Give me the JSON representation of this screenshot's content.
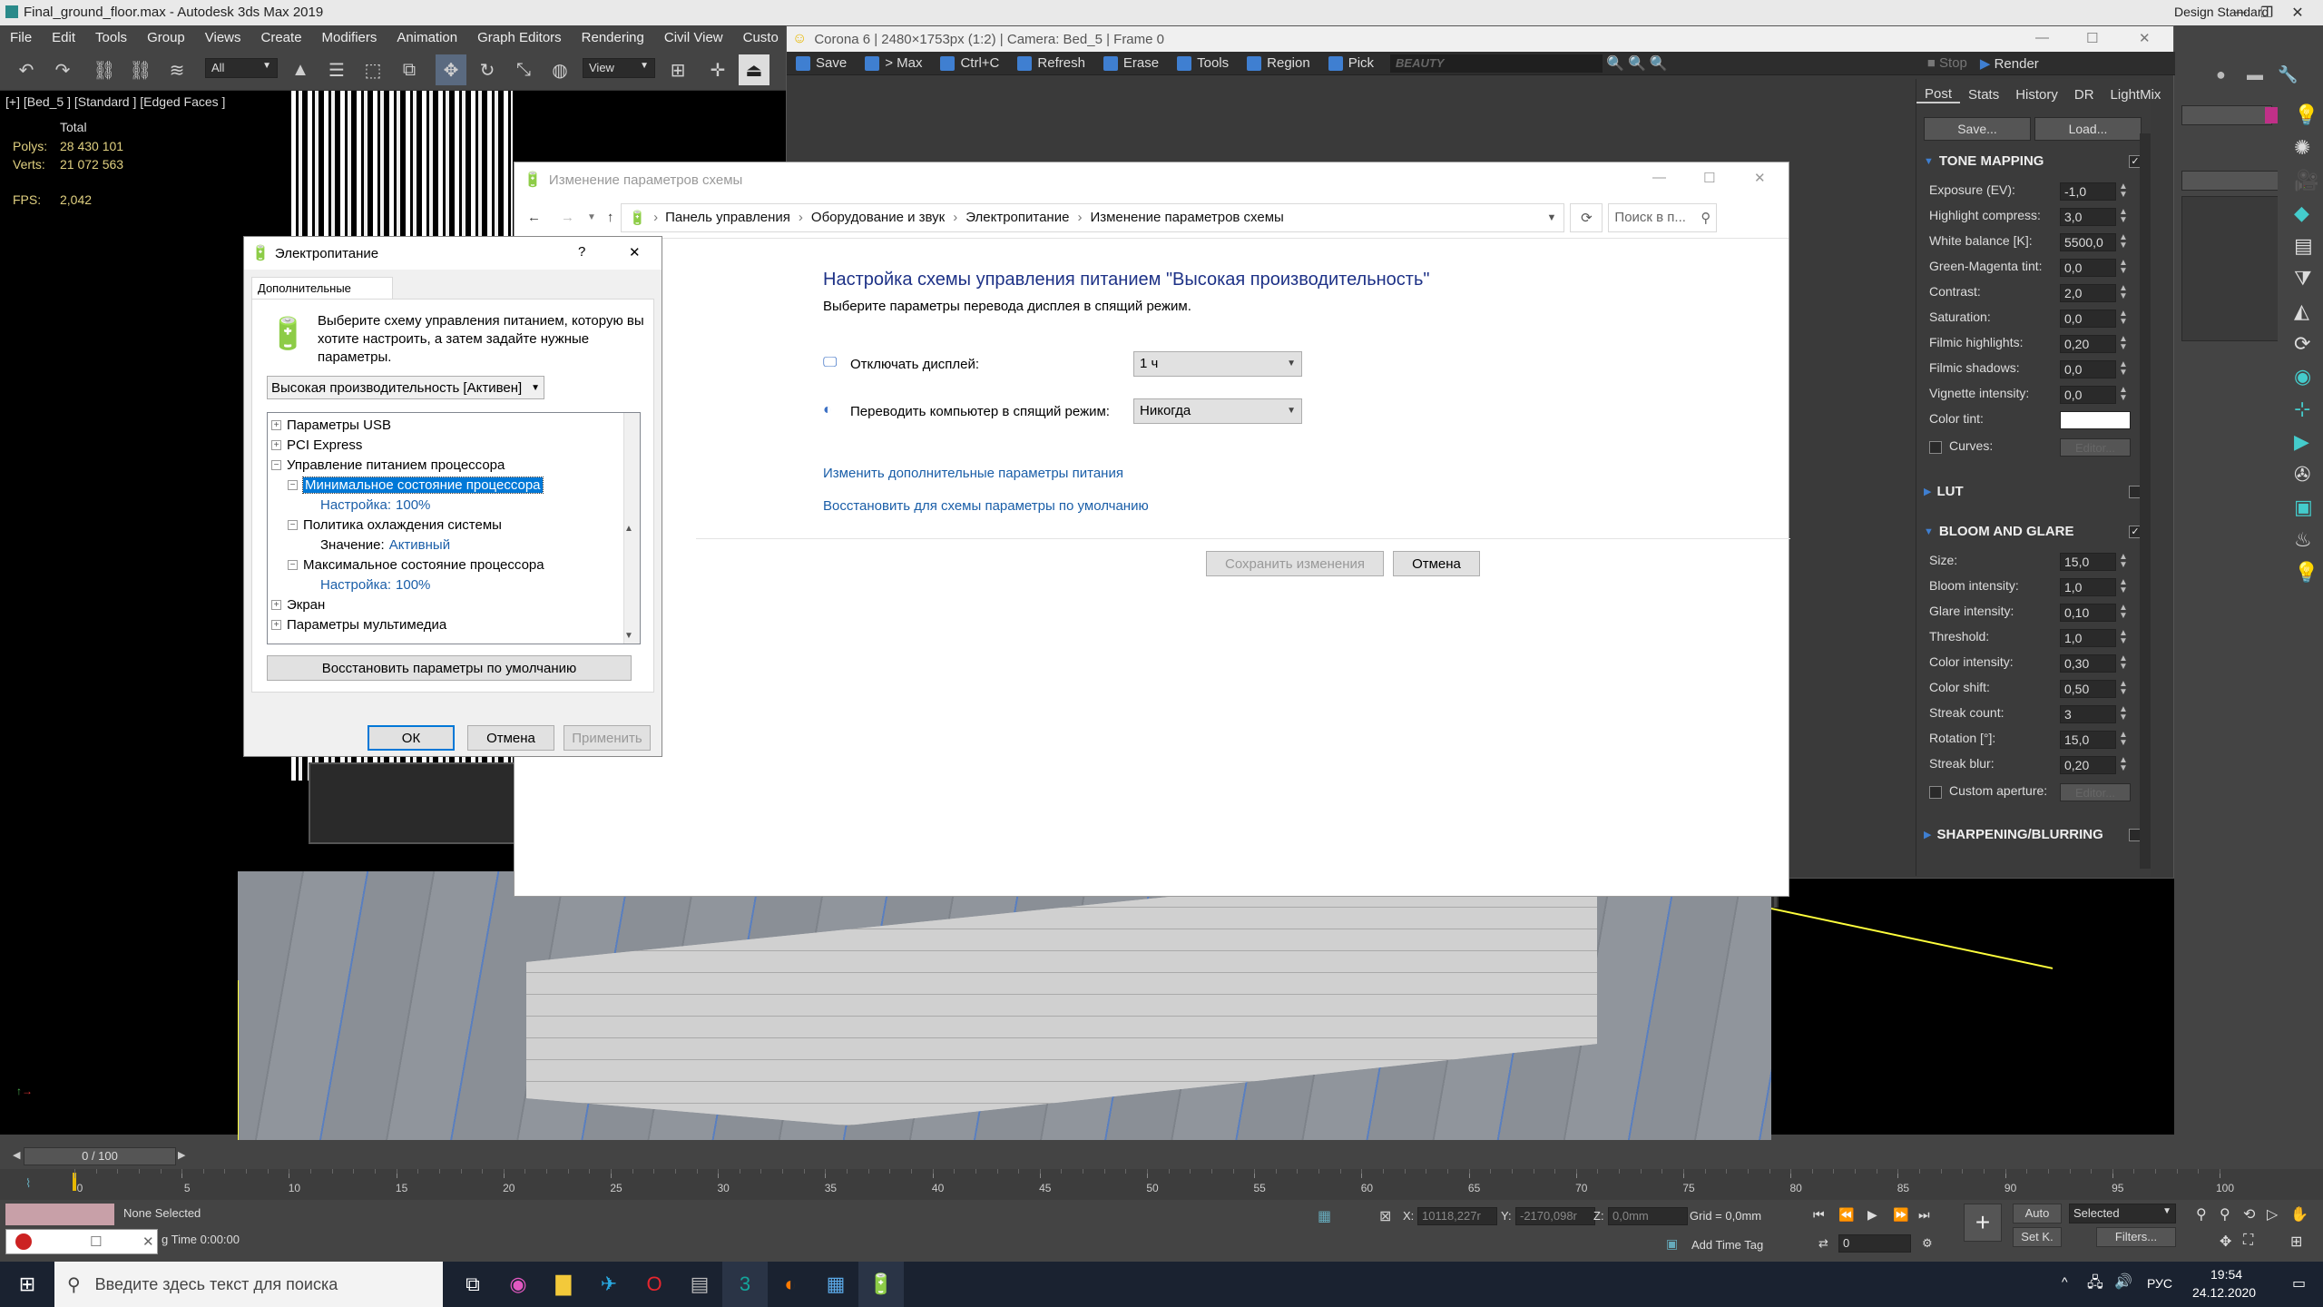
{
  "max": {
    "title": "Final_ground_floor.max - Autodesk 3ds Max 2019",
    "workspace": "Design Standard",
    "menu": [
      "File",
      "Edit",
      "Tools",
      "Group",
      "Views",
      "Create",
      "Modifiers",
      "Animation",
      "Graph Editors",
      "Rendering",
      "Civil View",
      "Custo"
    ],
    "selection_filter": "All",
    "view_dropdown": "View",
    "viewport_label": "[+] [Bed_5 ] [Standard ] [Edged Faces ]",
    "stats": {
      "total_label": "Total",
      "polys_label": "Polys:",
      "polys": "28 430 101",
      "verts_label": "Verts:",
      "verts": "21 072 563",
      "fps_label": "FPS:",
      "fps": "2,042"
    }
  },
  "corona": {
    "title": "Corona 6 | 2480×1753px (1:2) | Camera: Bed_5 | Frame 0",
    "toolbar": [
      "Save",
      "> Max",
      "Ctrl+C",
      "Refresh",
      "Erase",
      "Tools",
      "Region",
      "Pick"
    ],
    "channel": "BEAUTY",
    "stop": "Stop",
    "render": "Render",
    "tabs": [
      "Post",
      "Stats",
      "History",
      "DR",
      "LightMix"
    ],
    "save_btn": "Save...",
    "load_btn": "Load...",
    "tone_mapping": {
      "title": "TONE MAPPING",
      "rows": [
        {
          "label": "Exposure (EV):",
          "value": "-1,0"
        },
        {
          "label": "Highlight compress:",
          "value": "3,0"
        },
        {
          "label": "White balance [K]:",
          "value": "5500,0"
        },
        {
          "label": "Green-Magenta tint:",
          "value": "0,0"
        },
        {
          "label": "Contrast:",
          "value": "2,0"
        },
        {
          "label": "Saturation:",
          "value": "0,0"
        },
        {
          "label": "Filmic highlights:",
          "value": "0,20"
        },
        {
          "label": "Filmic shadows:",
          "value": "0,0"
        },
        {
          "label": "Vignette intensity:",
          "value": "0,0"
        }
      ],
      "color_tint": "Color tint:",
      "curves": "Curves:",
      "editor": "Editor..."
    },
    "lut": "LUT",
    "bloom": {
      "title": "BLOOM AND GLARE",
      "rows": [
        {
          "label": "Size:",
          "value": "15,0"
        },
        {
          "label": "Bloom intensity:",
          "value": "1,0"
        },
        {
          "label": "Glare intensity:",
          "value": "0,10"
        },
        {
          "label": "Threshold:",
          "value": "1,0"
        },
        {
          "label": "Color intensity:",
          "value": "0,30"
        },
        {
          "label": "Color shift:",
          "value": "0,50"
        },
        {
          "label": "Streak count:",
          "value": "3"
        },
        {
          "label": "Rotation [°]:",
          "value": "15,0"
        },
        {
          "label": "Streak blur:",
          "value": "0,20"
        }
      ],
      "custom_aperture": "Custom aperture:",
      "editor": "Editor..."
    },
    "sharpening": "SHARPENING/BLURRING"
  },
  "cpl": {
    "title": "Изменение параметров схемы",
    "crumbs": [
      "Панель управления",
      "Оборудование и звук",
      "Электропитание",
      "Изменение параметров схемы"
    ],
    "search_placeholder": "Поиск в п...",
    "heading": "Настройка схемы управления питанием \"Высокая производительность\"",
    "subheading": "Выберите параметры перевода дисплея в спящий режим.",
    "display_label": "Отключать дисплей:",
    "display_value": "1 ч",
    "sleep_label": "Переводить компьютер в спящий режим:",
    "sleep_value": "Никогда",
    "link_advanced": "Изменить дополнительные параметры питания",
    "link_restore": "Восстановить для схемы параметры по умолчанию",
    "save_btn": "Сохранить изменения",
    "cancel_btn": "Отмена"
  },
  "power": {
    "title": "Электропитание",
    "help": "?",
    "tab": "Дополнительные параметры",
    "intro": "Выберите схему управления питанием, которую вы хотите настроить, а затем задайте нужные параметры.",
    "scheme": "Высокая производительность [Активен]",
    "tree": {
      "usb": "Параметры USB",
      "pci": "PCI Express",
      "cpu": "Управление питанием процессора",
      "min_state": "Минимальное состояние процессора",
      "min_setting_label": "Настройка:",
      "min_setting_value": "100%",
      "cooling": "Политика охлаждения системы",
      "cooling_label": "Значение:",
      "cooling_value": "Активный",
      "max_state": "Максимальное состояние процессора",
      "max_setting_label": "Настройка:",
      "max_setting_value": "100%",
      "screen": "Экран",
      "multimedia": "Параметры мультимедиа"
    },
    "restore_btn": "Восстановить параметры по умолчанию",
    "ok": "ОК",
    "cancel": "Отмена",
    "apply": "Применить"
  },
  "timeline": {
    "frame": "0 / 100",
    "ticks": [
      "0",
      "5",
      "10",
      "15",
      "20",
      "25",
      "30",
      "35",
      "40",
      "45",
      "50",
      "55",
      "60",
      "65",
      "70",
      "75",
      "80",
      "85",
      "90",
      "95",
      "100"
    ],
    "none_selected": "None Selected",
    "time_label": "g Time  0:00:00",
    "x_label": "X:",
    "x_value": "10118,227r",
    "y_label": "Y:",
    "y_value": "-2170,098r",
    "z_label": "Z:",
    "z_value": "0,0mm",
    "grid": "Grid = 0,0mm",
    "add_time_tag": "Add Time Tag",
    "auto": "Auto",
    "selected": "Selected",
    "set_k": "Set K.",
    "filters": "Filters...",
    "frame_value": "0"
  },
  "taskbar": {
    "search_placeholder": "Введите здесь текст для поиска",
    "lang": "РУС",
    "time": "19:54",
    "date": "24.12.2020"
  },
  "colors": {
    "accent": "#1a5ea8",
    "selection": "#0078d7",
    "corona_blue": "#3f7fd1"
  }
}
